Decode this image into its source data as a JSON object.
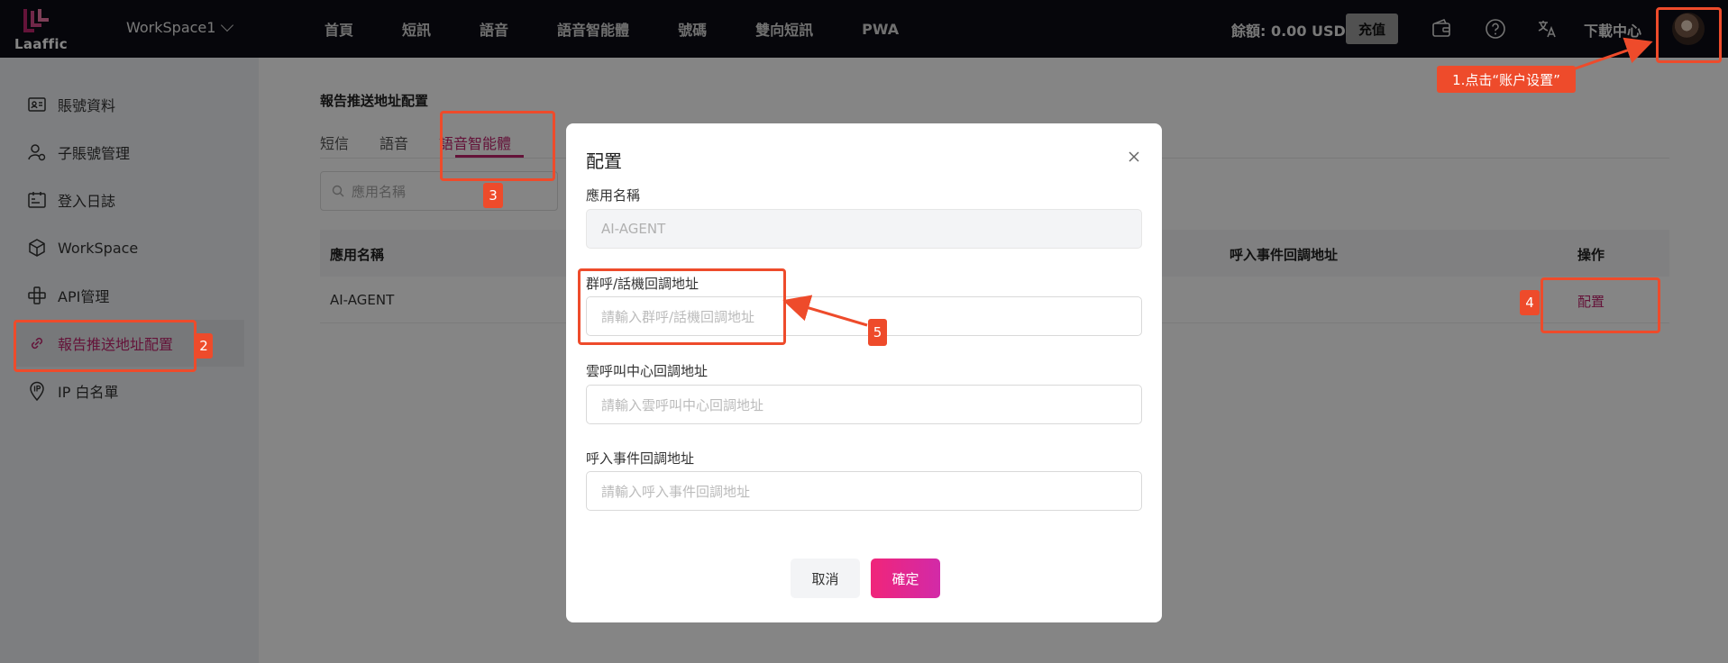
{
  "brand": {
    "logo_text": "Laaffic"
  },
  "topbar": {
    "workspace": "WorkSpace1",
    "nav": [
      "首頁",
      "短訊",
      "語音",
      "語音智能體",
      "號碼",
      "雙向短訊",
      "PWA"
    ],
    "balance": "餘額: 0.00 USD",
    "recharge": "充值",
    "download": "下載中心"
  },
  "sidebar": {
    "items": [
      {
        "label": "賬號資料",
        "icon": "id-card-icon"
      },
      {
        "label": "子賬號管理",
        "icon": "user-gear-icon"
      },
      {
        "label": "登入日誌",
        "icon": "log-icon"
      },
      {
        "label": "WorkSpace",
        "icon": "cube-icon"
      },
      {
        "label": "API管理",
        "icon": "api-icon"
      },
      {
        "label": "報告推送地址配置",
        "icon": "link-icon"
      },
      {
        "label": "IP 白名單",
        "icon": "ip-icon"
      }
    ],
    "active_index": 5
  },
  "page": {
    "title": "報告推送地址配置",
    "tabs": [
      "短信",
      "語音",
      "語音智能體"
    ],
    "active_tab": 2,
    "search_placeholder": "應用名稱",
    "table": {
      "headers": [
        "應用名稱",
        "呼入事件回調地址",
        "操作"
      ],
      "rows": [
        {
          "name": "AI-AGENT",
          "action": "配置"
        }
      ]
    }
  },
  "modal": {
    "title": "配置",
    "app_name_label": "應用名稱",
    "app_name_value": "AI-AGENT",
    "fields": [
      {
        "label": "群呼/話機回調地址",
        "placeholder": "請輸入群呼/話機回調地址"
      },
      {
        "label": "雲呼叫中心回調地址",
        "placeholder": "請輸入雲呼叫中心回調地址"
      },
      {
        "label": "呼入事件回調地址",
        "placeholder": "請輸入呼入事件回調地址"
      }
    ],
    "cancel": "取消",
    "confirm": "確定"
  },
  "annotations": {
    "step1": "1.点击“账户设置”",
    "step2": "2",
    "step3": "3",
    "step4": "4",
    "step5": "5",
    "color": "#ee4b2b"
  },
  "colors": {
    "accent": "#c0256e",
    "topbar": "#0d0d16"
  }
}
